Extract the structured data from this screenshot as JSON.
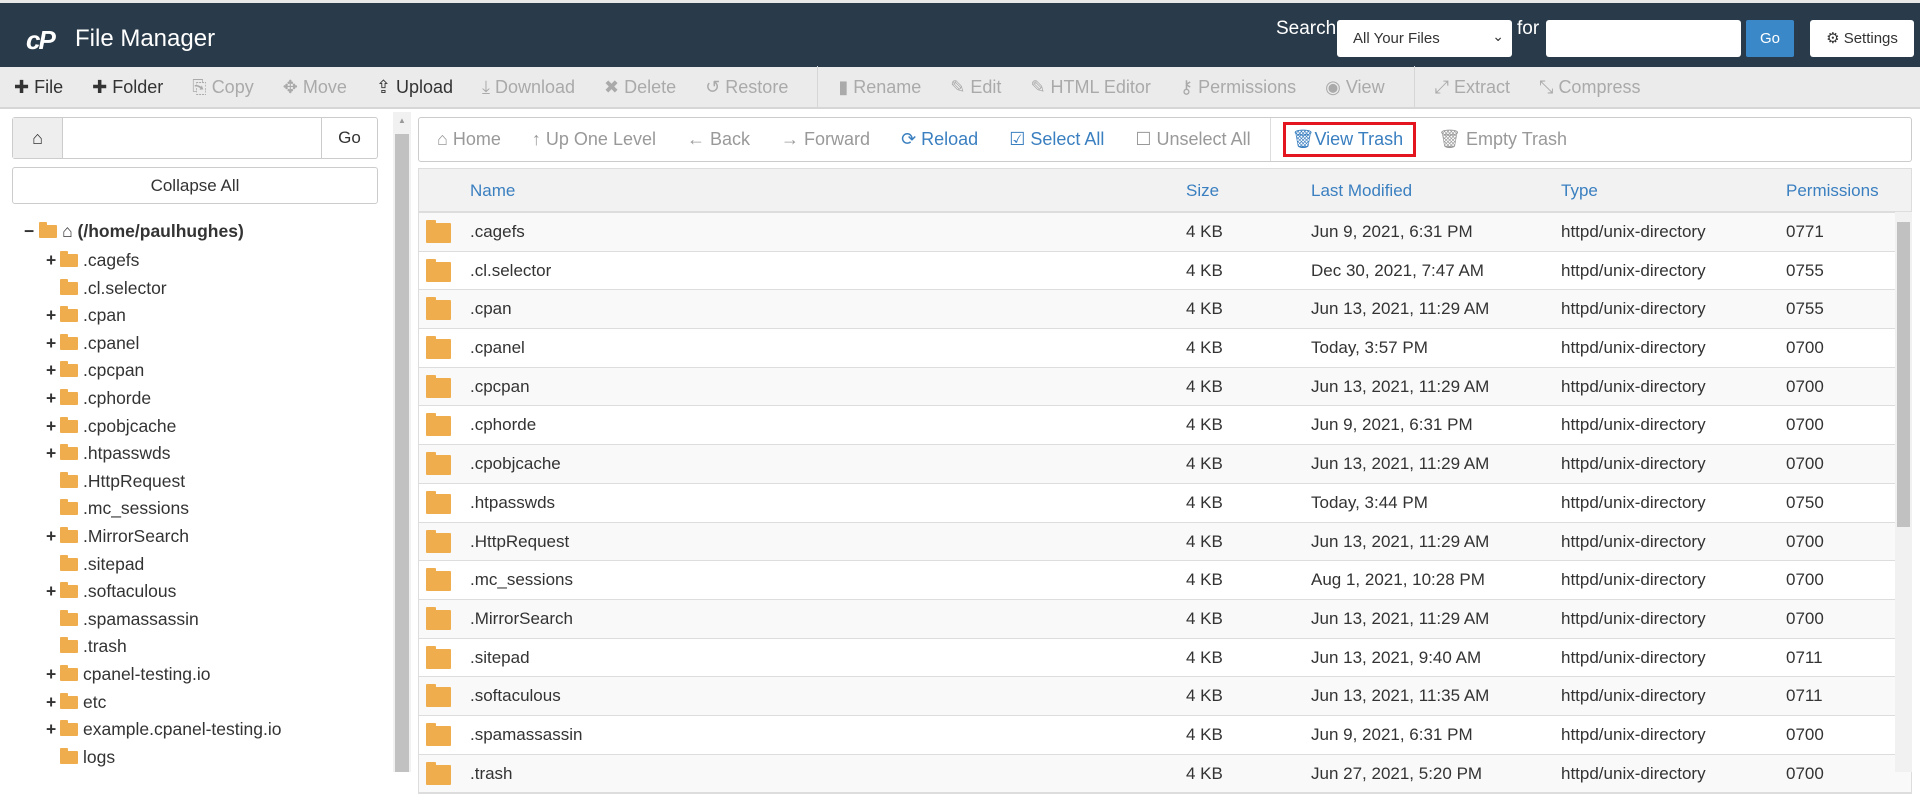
{
  "header": {
    "logo": "cP",
    "title": "File Manager",
    "search_label": "Search",
    "search_scope": "All Your Files",
    "for_label": "for",
    "search_value": "",
    "go": "Go",
    "settings": "Settings"
  },
  "toolbar": [
    {
      "label": "File",
      "icon": "plus-icon",
      "glyph": "✚",
      "enabled": true
    },
    {
      "label": "Folder",
      "icon": "plus-icon",
      "glyph": "✚",
      "enabled": true
    },
    {
      "label": "Copy",
      "icon": "copy-icon",
      "glyph": "⎘",
      "enabled": false
    },
    {
      "label": "Move",
      "icon": "move-icon",
      "glyph": "✥",
      "enabled": false
    },
    {
      "label": "Upload",
      "icon": "upload-icon",
      "glyph": "⇪",
      "enabled": true
    },
    {
      "label": "Download",
      "icon": "download-icon",
      "glyph": "⤓",
      "enabled": false
    },
    {
      "label": "Delete",
      "icon": "delete-icon",
      "glyph": "✖",
      "enabled": false
    },
    {
      "label": "Restore",
      "icon": "restore-icon",
      "glyph": "↺",
      "enabled": false
    },
    {
      "label": "Rename",
      "icon": "file-icon",
      "glyph": "▮",
      "enabled": false
    },
    {
      "label": "Edit",
      "icon": "pencil-icon",
      "glyph": "✎",
      "enabled": false
    },
    {
      "label": "HTML Editor",
      "icon": "edit-icon",
      "glyph": "✎",
      "enabled": false
    },
    {
      "label": "Permissions",
      "icon": "key-icon",
      "glyph": "⚷",
      "enabled": false
    },
    {
      "label": "View",
      "icon": "eye-icon",
      "glyph": "◉",
      "enabled": false
    },
    {
      "label": "Extract",
      "icon": "expand-icon",
      "glyph": "⤢",
      "enabled": false
    },
    {
      "label": "Compress",
      "icon": "compress-icon",
      "glyph": "⤡",
      "enabled": false
    }
  ],
  "sidebar": {
    "path_value": "",
    "go": "Go",
    "collapse_all": "Collapse All",
    "root": "(/home/paulhughes)",
    "items": [
      {
        "name": ".cagefs",
        "expandable": true
      },
      {
        "name": ".cl.selector",
        "expandable": false
      },
      {
        "name": ".cpan",
        "expandable": true
      },
      {
        "name": ".cpanel",
        "expandable": true
      },
      {
        "name": ".cpcpan",
        "expandable": true
      },
      {
        "name": ".cphorde",
        "expandable": true
      },
      {
        "name": ".cpobjcache",
        "expandable": true
      },
      {
        "name": ".htpasswds",
        "expandable": true
      },
      {
        "name": ".HttpRequest",
        "expandable": false
      },
      {
        "name": ".mc_sessions",
        "expandable": false
      },
      {
        "name": ".MirrorSearch",
        "expandable": true
      },
      {
        "name": ".sitepad",
        "expandable": false
      },
      {
        "name": ".softaculous",
        "expandable": true
      },
      {
        "name": ".spamassassin",
        "expandable": false
      },
      {
        "name": ".trash",
        "expandable": false
      },
      {
        "name": "cpanel-testing.io",
        "expandable": true
      },
      {
        "name": "etc",
        "expandable": true
      },
      {
        "name": "example.cpanel-testing.io",
        "expandable": true
      },
      {
        "name": "logs",
        "expandable": false
      }
    ]
  },
  "nav": {
    "home": "Home",
    "up": "Up One Level",
    "back": "Back",
    "forward": "Forward",
    "reload": "Reload",
    "select_all": "Select All",
    "unselect_all": "Unselect All",
    "view_trash": "View Trash",
    "empty_trash": "Empty Trash"
  },
  "table": {
    "columns": [
      "Name",
      "Size",
      "Last Modified",
      "Type",
      "Permissions"
    ],
    "rows": [
      [
        ".cagefs",
        "4 KB",
        "Jun 9, 2021, 6:31 PM",
        "httpd/unix-directory",
        "0771"
      ],
      [
        ".cl.selector",
        "4 KB",
        "Dec 30, 2021, 7:47 AM",
        "httpd/unix-directory",
        "0755"
      ],
      [
        ".cpan",
        "4 KB",
        "Jun 13, 2021, 11:29 AM",
        "httpd/unix-directory",
        "0755"
      ],
      [
        ".cpanel",
        "4 KB",
        "Today, 3:57 PM",
        "httpd/unix-directory",
        "0700"
      ],
      [
        ".cpcpan",
        "4 KB",
        "Jun 13, 2021, 11:29 AM",
        "httpd/unix-directory",
        "0700"
      ],
      [
        ".cphorde",
        "4 KB",
        "Jun 9, 2021, 6:31 PM",
        "httpd/unix-directory",
        "0700"
      ],
      [
        ".cpobjcache",
        "4 KB",
        "Jun 13, 2021, 11:29 AM",
        "httpd/unix-directory",
        "0700"
      ],
      [
        ".htpasswds",
        "4 KB",
        "Today, 3:44 PM",
        "httpd/unix-directory",
        "0750"
      ],
      [
        ".HttpRequest",
        "4 KB",
        "Jun 13, 2021, 11:29 AM",
        "httpd/unix-directory",
        "0700"
      ],
      [
        ".mc_sessions",
        "4 KB",
        "Aug 1, 2021, 10:28 PM",
        "httpd/unix-directory",
        "0700"
      ],
      [
        ".MirrorSearch",
        "4 KB",
        "Jun 13, 2021, 11:29 AM",
        "httpd/unix-directory",
        "0700"
      ],
      [
        ".sitepad",
        "4 KB",
        "Jun 13, 2021, 9:40 AM",
        "httpd/unix-directory",
        "0711"
      ],
      [
        ".softaculous",
        "4 KB",
        "Jun 13, 2021, 11:35 AM",
        "httpd/unix-directory",
        "0711"
      ],
      [
        ".spamassassin",
        "4 KB",
        "Jun 9, 2021, 6:31 PM",
        "httpd/unix-directory",
        "0700"
      ],
      [
        ".trash",
        "4 KB",
        "Jun 27, 2021, 5:20 PM",
        "httpd/unix-directory",
        "0700"
      ]
    ]
  },
  "colors": {
    "header_bg": "#293a4a",
    "accent": "#3a7fc0",
    "folder": "#f0ad4e",
    "highlight": "#e3151f"
  }
}
